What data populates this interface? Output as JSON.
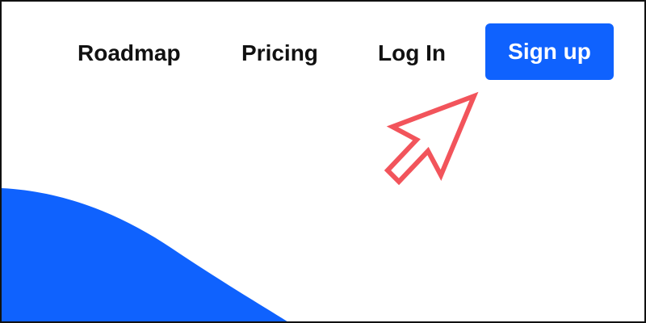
{
  "nav": {
    "links": [
      {
        "label": "Roadmap"
      },
      {
        "label": "Pricing"
      },
      {
        "label": "Log In"
      }
    ],
    "signup_label": "Sign up"
  },
  "decor": {
    "cursor_icon": "arrow-cursor-icon",
    "cursor_color": "#f2545b",
    "accent_color": "#0f62fe"
  }
}
